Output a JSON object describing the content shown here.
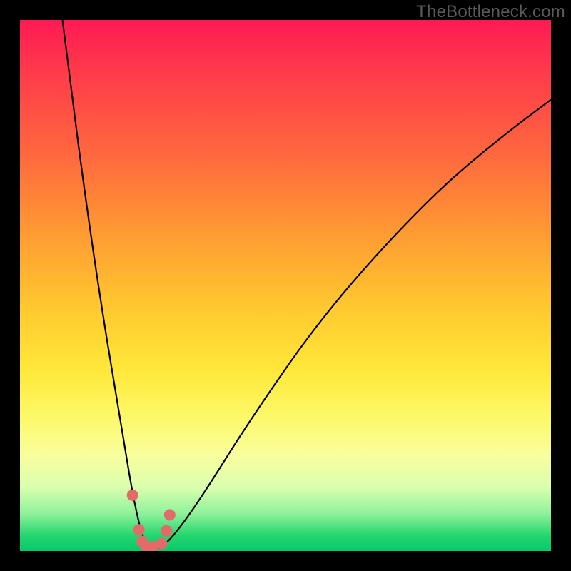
{
  "watermark": "TheBottleneck.com",
  "chart_data": {
    "type": "line",
    "title": "",
    "xlabel": "",
    "ylabel": "",
    "xlim": [
      0,
      100
    ],
    "ylim": [
      0,
      100
    ],
    "grid": false,
    "legend": false,
    "series": [
      {
        "name": "bottleneck-curve",
        "x": [
          8,
          10,
          12,
          14,
          16,
          18,
          20,
          21,
          22,
          23,
          24,
          25,
          26,
          27,
          29,
          32,
          36,
          41,
          47,
          54,
          62,
          71,
          81,
          92,
          100
        ],
        "y": [
          100,
          84,
          69,
          55,
          42,
          30,
          18,
          12,
          7,
          3,
          1,
          0.5,
          0.5,
          1,
          3,
          7,
          13,
          21,
          30,
          40,
          50,
          60,
          70,
          79,
          85
        ]
      },
      {
        "name": "highlight-markers",
        "style": "points",
        "x": [
          21.2,
          22.4,
          23.0,
          23.7,
          25.0,
          26.7,
          27.6,
          28.2
        ],
        "y": [
          10.5,
          4.0,
          1.8,
          0.9,
          0.8,
          1.4,
          3.8,
          6.8
        ]
      }
    ],
    "background_gradient": {
      "top": "#ff1a53",
      "mid": "#ffe83a",
      "bottom": "#07c96b"
    }
  }
}
